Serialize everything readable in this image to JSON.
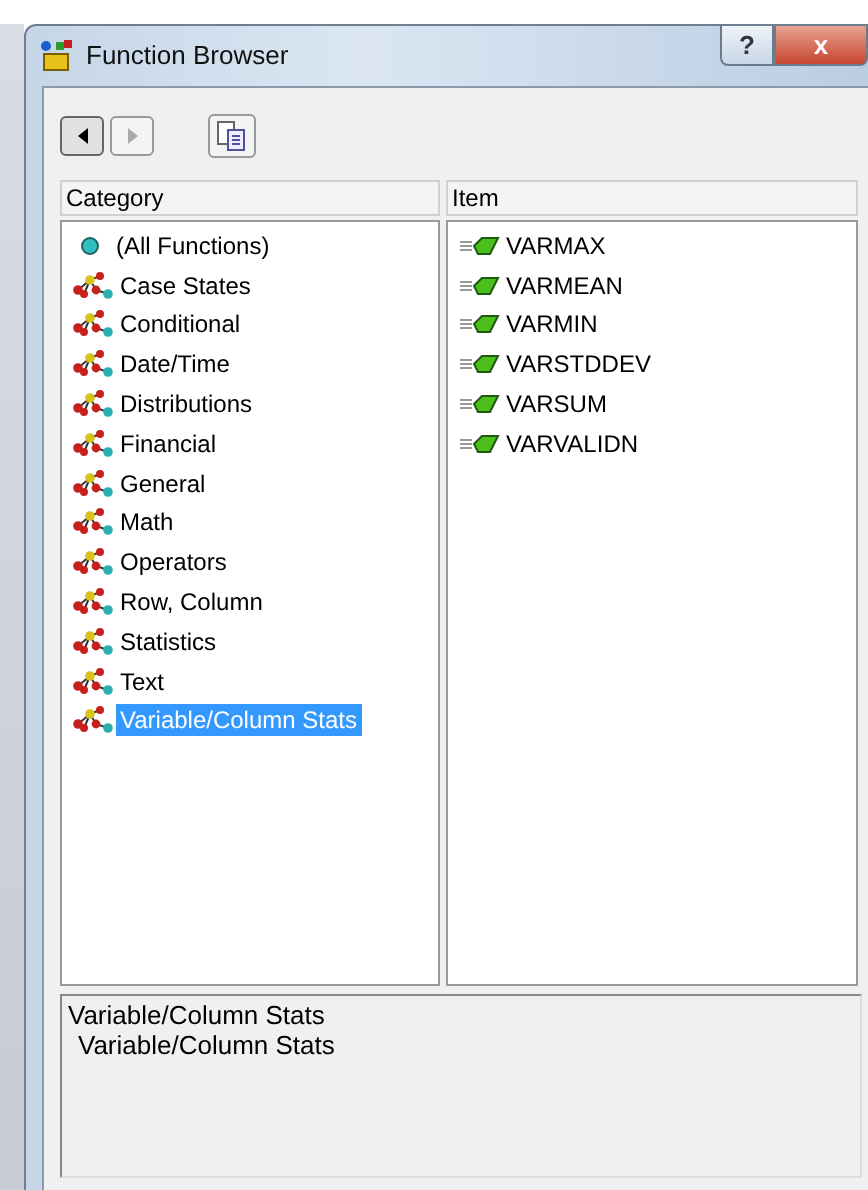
{
  "window": {
    "title": "Function Browser",
    "buttons": [
      {
        "kind": "help",
        "label": "?"
      },
      {
        "kind": "close",
        "label": "x"
      }
    ]
  },
  "toolbar": [
    {
      "kind": "back",
      "disabled": false
    },
    {
      "kind": "forward",
      "disabled": true
    },
    {
      "kind": "copy",
      "disabled": false
    }
  ],
  "category": {
    "heading": "Category",
    "items": [
      {
        "label": "(All Functions)",
        "kind": "all",
        "selected": false
      },
      {
        "label": "Case States",
        "kind": "group",
        "selected": false
      },
      {
        "label": "Conditional",
        "kind": "group",
        "selected": false
      },
      {
        "label": "Date/Time",
        "kind": "group",
        "selected": false
      },
      {
        "label": "Distributions",
        "kind": "group",
        "selected": false
      },
      {
        "label": "Financial",
        "kind": "group",
        "selected": false
      },
      {
        "label": "General",
        "kind": "group",
        "selected": false
      },
      {
        "label": "Math",
        "kind": "group",
        "selected": false
      },
      {
        "label": "Operators",
        "kind": "group",
        "selected": false
      },
      {
        "label": "Row, Column",
        "kind": "group",
        "selected": false
      },
      {
        "label": "Statistics",
        "kind": "group",
        "selected": false
      },
      {
        "label": "Text",
        "kind": "group",
        "selected": false
      },
      {
        "label": "Variable/Column Stats",
        "kind": "group",
        "selected": true
      }
    ]
  },
  "item": {
    "heading": "Item",
    "items": [
      {
        "label": "VARMAX"
      },
      {
        "label": "VARMEAN"
      },
      {
        "label": "VARMIN"
      },
      {
        "label": "VARSTDDEV"
      },
      {
        "label": "VARSUM"
      },
      {
        "label": "VARVALIDN"
      }
    ]
  },
  "description": {
    "title": "Variable/Column Stats",
    "text": "Variable/Column Stats"
  }
}
